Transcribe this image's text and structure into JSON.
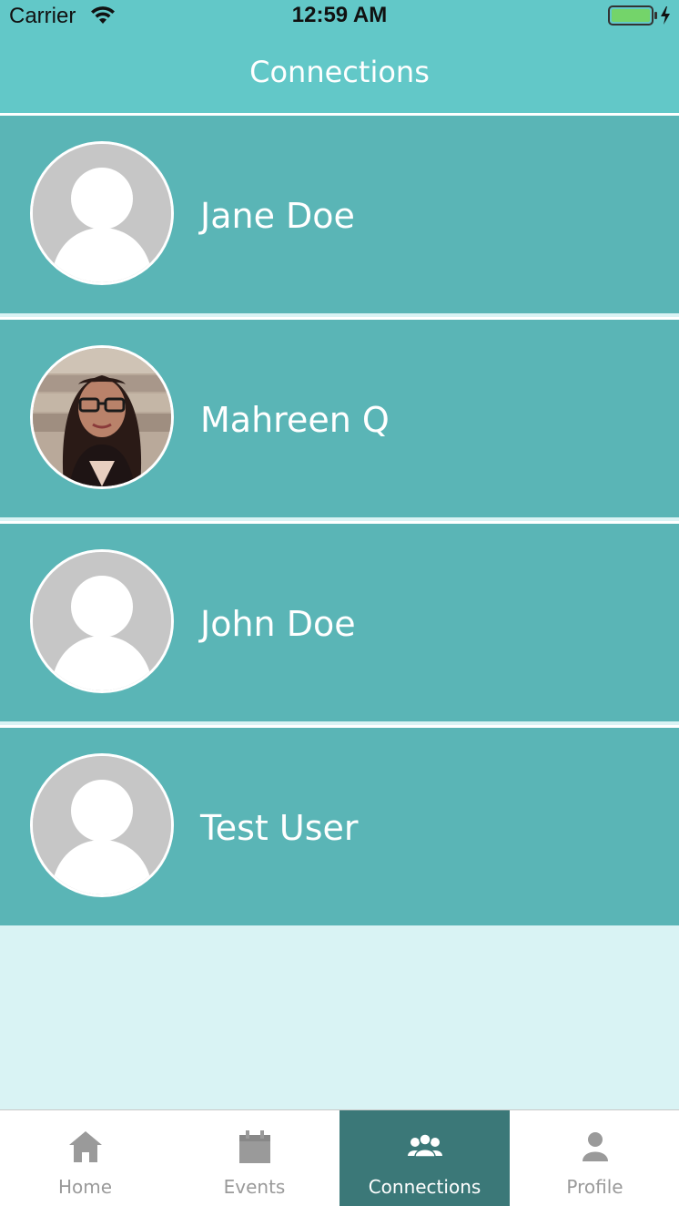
{
  "status_bar": {
    "carrier": "Carrier",
    "time": "12:59 AM",
    "battery_color": "#74d46a"
  },
  "header": {
    "title": "Connections",
    "background": "#62c8c8"
  },
  "connections": [
    {
      "name": "Jane Doe",
      "avatar": "placeholder-avatar"
    },
    {
      "name": "Mahreen Q",
      "avatar": "photo-avatar"
    },
    {
      "name": "John Doe",
      "avatar": "placeholder-avatar"
    },
    {
      "name": "Test User",
      "avatar": "placeholder-avatar"
    }
  ],
  "row_color": "#5ab5b6",
  "tabbar": {
    "tabs": [
      {
        "label": "Home",
        "icon": "home-icon",
        "active": false
      },
      {
        "label": "Events",
        "icon": "calendar-icon",
        "active": false
      },
      {
        "label": "Connections",
        "icon": "people-icon",
        "active": true
      },
      {
        "label": "Profile",
        "icon": "person-icon",
        "active": false
      }
    ],
    "active_color": "#3b7878"
  }
}
